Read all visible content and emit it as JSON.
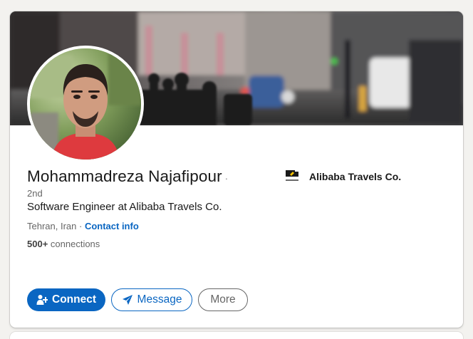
{
  "profile": {
    "name": "Mohammadreza Najafipour",
    "separator": "·",
    "degree": "2nd",
    "headline": "Software Engineer at Alibaba Travels Co.",
    "location": "Tehran, Iran",
    "location_separator": " · ",
    "contact_info_label": "Contact info",
    "connections_count": "500+",
    "connections_label": " connections"
  },
  "company": {
    "name": "Alibaba Travels Co.",
    "logo_icon": "alibaba-logo-icon"
  },
  "actions": {
    "connect_label": "Connect",
    "connect_icon": "person-add-icon",
    "message_label": "Message",
    "message_icon": "paper-plane-icon",
    "more_label": "More"
  },
  "colors": {
    "accent": "#0a66c2",
    "background": "#f3f2ef",
    "card": "#ffffff",
    "muted_text": "#666666"
  }
}
